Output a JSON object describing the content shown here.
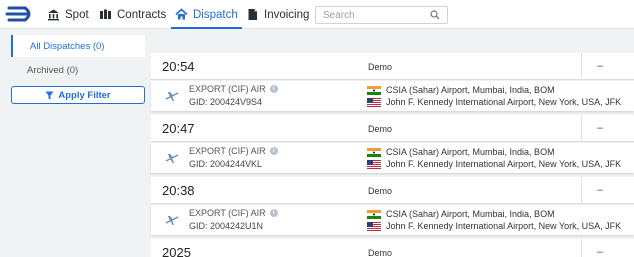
{
  "nav": {
    "items": [
      {
        "label": "Spot",
        "icon": "bank-icon"
      },
      {
        "label": "Contracts",
        "icon": "columns-icon"
      },
      {
        "label": "Dispatch",
        "icon": "home-icon",
        "active": true
      },
      {
        "label": "Invoicing",
        "icon": "document-icon"
      }
    ],
    "search_placeholder": "Search",
    "accent": "#1f6fd6"
  },
  "sidebar": {
    "all_label": "All Dispatches (0)",
    "archived_label": "Archived (0)",
    "filter_label": "Apply Filter"
  },
  "dispatches": [
    {
      "time": "20:54",
      "mode": "Demo",
      "status": "–",
      "type": "EXPORT (CIF) AIR",
      "gid": "GID: 200424V9S4",
      "from": "CSIA (Sahar) Airport, Mumbai, India, BOM",
      "to": "John F. Kennedy International Airport, New York, USA, JFK"
    },
    {
      "time": "20:47",
      "mode": "Demo",
      "status": "–",
      "type": "EXPORT (CIF) AIR",
      "gid": "GID: 2004244VKL",
      "from": "CSIA (Sahar) Airport, Mumbai, India, BOM",
      "to": "John F. Kennedy International Airport, New York, USA, JFK"
    },
    {
      "time": "20:38",
      "mode": "Demo",
      "status": "–",
      "type": "EXPORT (CIF) AIR",
      "gid": "GID: 2004242U1N",
      "from": "CSIA (Sahar) Airport, Mumbai, India, BOM",
      "to": "John F. Kennedy International Airport, New York, USA, JFK"
    },
    {
      "time": "2025",
      "mode": "Demo",
      "status": "–"
    }
  ]
}
